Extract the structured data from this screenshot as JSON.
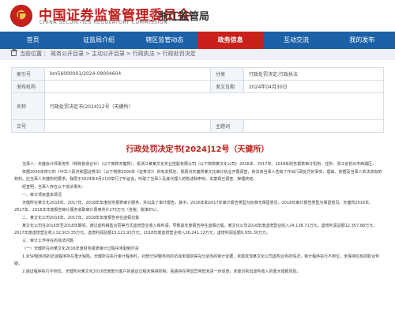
{
  "header": {
    "title": "中国证券监督管理委员会",
    "subtitle": "CHINA SECURITIES REGULATORY COMMISSION",
    "bureau": "浙江监管局"
  },
  "nav": {
    "items": [
      "首页",
      "证监局介绍",
      "辖区监管动态",
      "政务信息",
      "互动交流",
      "我的发布"
    ],
    "active_index": 3
  },
  "breadcrumb": [
    "当前位置",
    "政务公开目录",
    "主动公开目录",
    "行政执法",
    "行政处罚决定"
  ],
  "meta": {
    "index_label": "索引号",
    "index_value": "bm56000001/2024-09004604",
    "category_label": "分类",
    "category_value": "行政处罚决定;行政执法",
    "issuer_label": "发布机构",
    "issuer_value": "",
    "date_label": "发文日期",
    "date_value": "2024年04月30日",
    "name_label": "名称",
    "name_value": "行政处罚决定书(2024)12号（天健所）",
    "docno_label": "文号",
    "docno_value": "",
    "subject_label": "主题词",
    "subject_value": ""
  },
  "doc": {
    "title": "行政处罚决定书[2024]12号（天健所）",
    "paragraphs": [
      "当事人：天健会计师事务所（特殊普通合伙）（以下简称天健所），系浙江某某文化实业控股有限公司（以下简称某文化公司）2016年、2017年、2018年财务报表审计机构，住所：浙江省杭州市西湖区。",
      "依据2005年修订的《中华人民共和国证券法》（以下简称2005年《证券法》）的有关规定，我局对天健所某文化审计执业开展调查，依法向当事人告知了作出行政处罚的事实、理由、依据及当事人依法享有的权利。应当事人天健所的要求，我局于2024年4月11日举行了听证会，听取了当事人及其代理人的陈述和申辩。本案现已调查、审理终结。",
      "经查明，当事人存在以下违法事实：",
      "一、审计项目基本情况",
      "天健所在某文化2016年、2017年、2018年年度财务报表审计服务，并出具了审计报告。其中，2016年和2017年审计报告类型为标准无保留意见，2018年审计报告类型为保留意见。天健所2016年、2017年、2018年年度报告审计服务收取审计费用共计275万元（含税，税率6%）。",
      "二、某文化公司2016年、2017年、2018年年度报告存在虚假记载",
      "某文化公司在2016年至2018年期间，通过虚构销售合同等方式虚增营业收入和利润，导致其年度报告存在虚假记载。某文化公司2016年度虚增营业收入24,138.71万元，虚增利润总额12,357.88万元；2017年度虚增营业收入32,915.35万元，虚增利润总额15,121.93万元；2018年度虚增营业收入26,241.12万元，虚增利润总额9,935.30万元。",
      "三、审计工作存在的违法问题",
      "（一）天健所在对某文化2016年度财务报表审计过程中未勤勉尽责",
      "1.对SP服务商的访谈程序存在重大缺陷。天健所在执行审计程序时，对部分SP服务商的访谈未能取得充分适当的审计证据，未能发现某文化公司虚构业务的情况，审计程序执行不到位，未保持应有的职业怀疑。",
      "2.函证程序执行不到位。天健所对某文化2016年度部分客户的函证过程未保持控制，回函存在明显异常但未进一步追查，未能识别出虚构收入的重大错报风险。"
    ]
  }
}
